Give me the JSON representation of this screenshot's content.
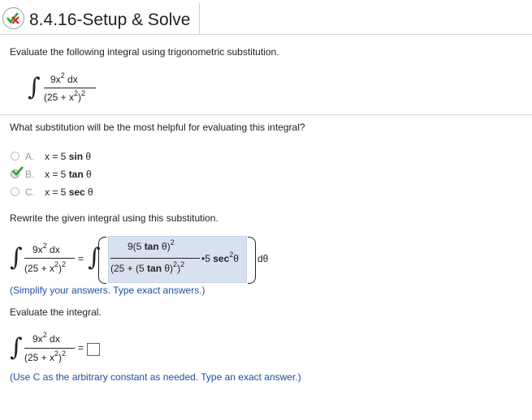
{
  "header": {
    "title": "8.4.16-Setup & Solve"
  },
  "question": {
    "prompt": "Evaluate the following integral using trigonometric substitution.",
    "integral": {
      "numerator": "9x",
      "num_exp": "2",
      "num_dx": " dx",
      "den_open": "(25 + x",
      "den_exp": "2",
      "den_close": ")",
      "outer_exp": "2"
    }
  },
  "sub_question": {
    "prompt": "What substitution will be the most helpful for evaluating this integral?",
    "options": [
      {
        "letter": "A.",
        "eq": "x = 5 ",
        "fn": "sin",
        "var": " θ",
        "state": "unselected"
      },
      {
        "letter": "B.",
        "eq": "x = 5 ",
        "fn": "tan",
        "var": " θ",
        "state": "correct"
      },
      {
        "letter": "C.",
        "eq": "x = 5 ",
        "fn": "sec",
        "var": " θ",
        "state": "unselected"
      }
    ]
  },
  "rewrite": {
    "prompt": "Rewrite the given integral using this substitution.",
    "equals": "=",
    "inner_num_pre": "9(5 ",
    "inner_num_fn": "tan",
    "inner_num_post": " θ)",
    "inner_num_exp": "2",
    "inner_den_pre": "(25 + (5 ",
    "inner_den_fn": "tan",
    "inner_den_post": " θ)",
    "inner_den_exp1": "2",
    "inner_den_close": ")",
    "inner_den_exp2": "2",
    "times": "•5 ",
    "sec_fn": "sec",
    "sec_exp": "2",
    "sec_var": "θ",
    "dtheta": "dθ",
    "hint": "(Simplify your answers. Type exact answers.)"
  },
  "evaluate": {
    "prompt": "Evaluate the integral.",
    "equals": "=",
    "hint": "(Use C as the arbitrary constant as needed. Type an exact answer.)"
  },
  "colors": {
    "accent_blue": "#1d4fa0",
    "shade": "#d7e1f0",
    "check_green": "#2e9e2e",
    "x_red": "#d32020"
  }
}
